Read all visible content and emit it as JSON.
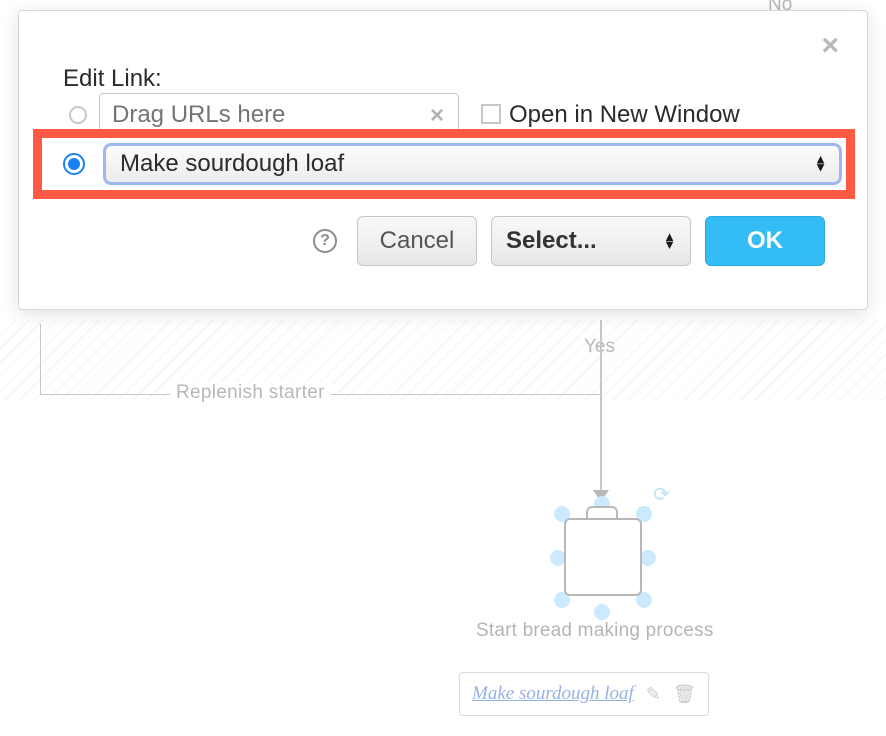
{
  "dialog": {
    "title": "Edit Link:",
    "url_input_placeholder": "Drag URLs here",
    "open_new_window_label": "Open in New Window",
    "selected_link_value": "Make sourdough loaf",
    "help_glyph": "?",
    "cancel_label": "Cancel",
    "select_label": "Select...",
    "ok_label": "OK"
  },
  "diagram": {
    "no_label": "No",
    "yes_label": "Yes",
    "replenish_label": "Replenish starter",
    "subroutine_label": "Start bread making process",
    "link_chip_text": "Make sourdough loaf"
  }
}
